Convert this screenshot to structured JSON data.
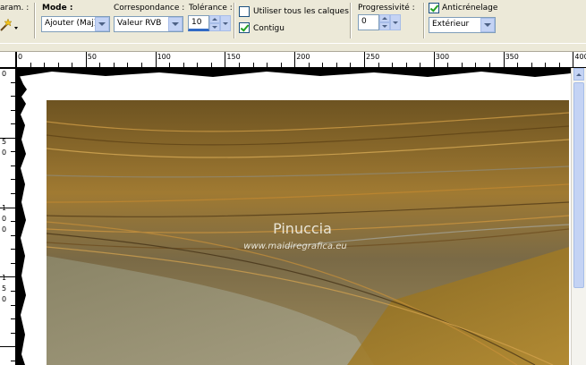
{
  "toolbar": {
    "param_label": "aram. :",
    "mode_label": "Mode :",
    "mode_value": "Ajouter (Maj)",
    "correspondance_label": "Correspondance :",
    "correspondance_value": "Valeur RVB",
    "tolerance_label": "Tolérance :",
    "tolerance_value": "10",
    "use_all_layers_label": "Utiliser tous les calques",
    "contiguous_label": "Contigu",
    "progressivite_label": "Progressivité :",
    "progressivite_value": "0",
    "anticrenelage_label": "Anticrénelage",
    "anticrenelage_value": "Extérieur"
  },
  "ruler_top": {
    "labels": [
      "0",
      "50",
      "100",
      "150",
      "200",
      "250",
      "300",
      "350",
      "400"
    ]
  },
  "ruler_left": {
    "labels": [
      "0",
      "5",
      "0",
      "1",
      "0",
      "0",
      "1",
      "5",
      "0"
    ]
  },
  "watermark": {
    "name": "Pinuccia",
    "url": "www.maidiregrafica.eu"
  },
  "colors": {
    "toolbar_bg": "#ece9d8",
    "accent_blue": "#c4d3f4",
    "check_green": "#21a121"
  }
}
